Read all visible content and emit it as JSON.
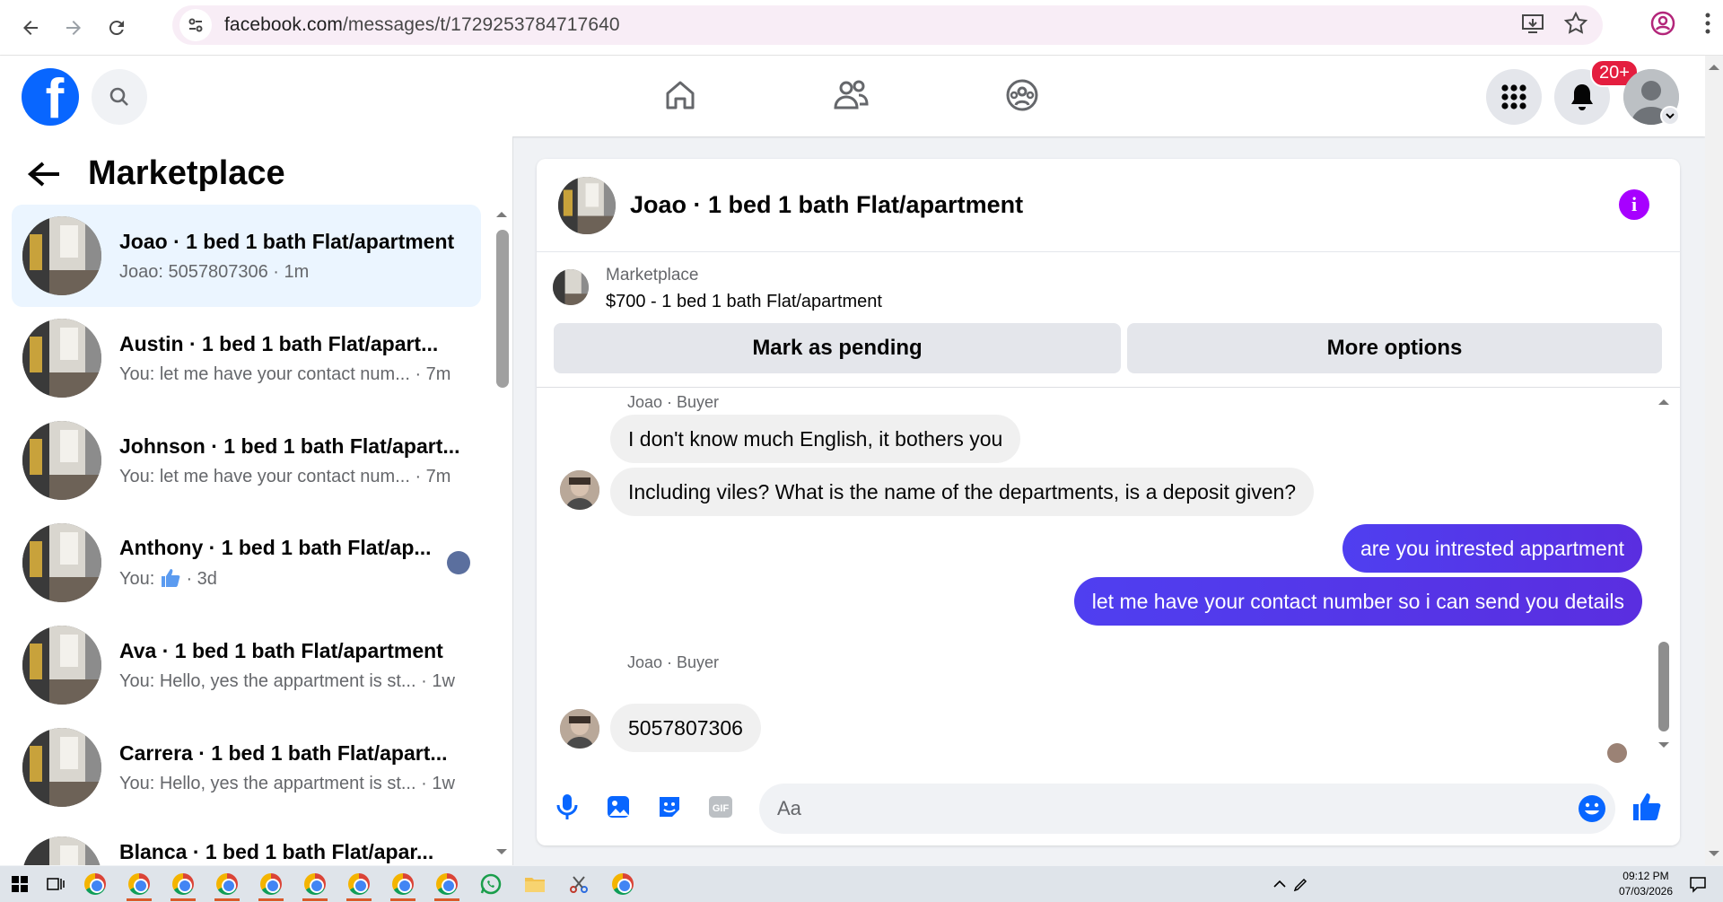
{
  "browser": {
    "url_host": "facebook.com",
    "url_path": "/messages/t/1729253784717640"
  },
  "fb_nav": {
    "notification_badge": "20+"
  },
  "left_panel": {
    "title": "Marketplace",
    "threads": [
      {
        "name": "Joao · 1 bed 1 bath Flat/apartment",
        "sub": "Joao: 5057807306 · 1m",
        "active": true
      },
      {
        "name": "Austin · 1 bed 1 bath Flat/apart...",
        "sub": "You: let me have your contact num... · 7m"
      },
      {
        "name": "Johnson · 1 bed 1 bath Flat/apart...",
        "sub": "You: let me have your contact num... · 7m"
      },
      {
        "name": "Anthony · 1 bed 1 bath Flat/ap...",
        "sub_prefix": "You:",
        "sub_suffix": "· 3d"
      },
      {
        "name": "Ava · 1 bed 1 bath Flat/apartment",
        "sub": "You: Hello, yes the appartment is st... · 1w"
      },
      {
        "name": "Carrera · 1 bed 1 bath Flat/apart...",
        "sub": "You: Hello, yes the appartment is st... · 1w"
      },
      {
        "name": "Blanca · 1 bed 1 bath Flat/apar...",
        "sub": ""
      }
    ]
  },
  "chat": {
    "title": "Joao · 1 bed 1 bath Flat/apartment",
    "listing": {
      "label": "Marketplace",
      "price_title": "$700 - 1 bed 1 bath Flat/apartment",
      "btn_pending": "Mark as pending",
      "btn_more": "More options"
    },
    "messages": {
      "sender1": "Joao · Buyer",
      "in1": "I don't know much English, it bothers you",
      "in2": "Including viles? What is the name of the departments, is a deposit given?",
      "out1": "are you intrested appartment",
      "out2": "let me have your contact number so i can send you details",
      "sender2": "Joao · Buyer",
      "in3": "5057807306"
    },
    "composer_placeholder": "Aa"
  },
  "taskbar": {
    "time": "09:12 PM",
    "date": "07/03/2026"
  },
  "colors": {
    "fb_blue": "#0866ff",
    "outgoing_bubble": "#5b2ef2",
    "badge_red": "#e41e3f",
    "info_purple": "#a700ff"
  }
}
